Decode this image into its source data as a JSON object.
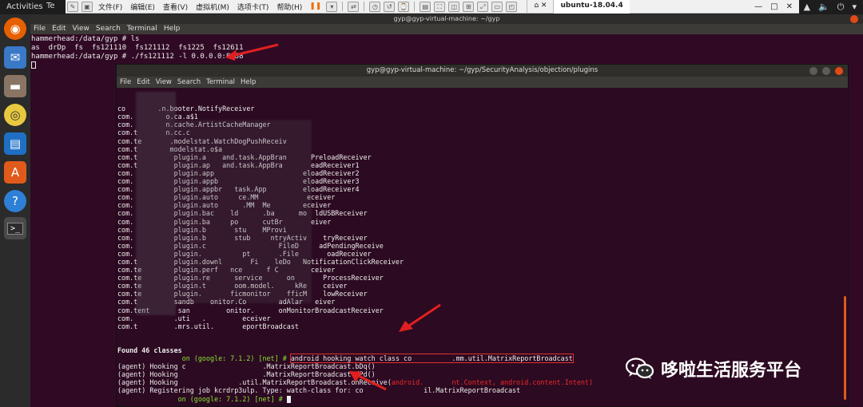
{
  "topbar": {
    "activities": "Activities",
    "vm_tab": "Te",
    "tray": [
      "▲",
      "🔈",
      "⏻",
      "▾"
    ]
  },
  "vmware": {
    "menus": [
      "文件(F)",
      "编辑(E)",
      "查看(V)",
      "虚拟机(M)",
      "选项卡(T)",
      "帮助(H)"
    ],
    "tab": "ubuntu-18.04.4",
    "window_controls": [
      "—",
      "□",
      "✕"
    ]
  },
  "dock": {
    "apps": [
      "firefox-icon",
      "thunderbird-icon",
      "files-icon",
      "rhythmbox-icon",
      "writer-icon",
      "software-icon",
      "help-icon",
      "terminal-icon"
    ]
  },
  "terminal_back": {
    "title": "gyp@gyp-virtual-machine: ~/gyp",
    "menus": [
      "File",
      "Edit",
      "View",
      "Search",
      "Terminal",
      "Help"
    ],
    "lines": [
      "hammerhead:/data/gyp # ls",
      "as  drDp  fs  fs121110  fs121112  fs1225  fs12611",
      "hammerhead:/data/gyp # ./fs121112 -l 0.0.0.0:8888"
    ]
  },
  "terminal_front": {
    "title": "gyp@gyp-virtual-machine: ~/gyp/SecurityAnalysis/objection/plugins",
    "menus": [
      "File",
      "Edit",
      "View",
      "Search",
      "Terminal",
      "Help"
    ],
    "class_lines": [
      "co        .n.booter.NotifyReceiver",
      "com.        o.ca.a$1",
      "com.        n.cache.ArtistCacheManager",
      "com.t       n.cc.c",
      "com.te       .modelstat.WatchDogPushReceiv",
      "com.t        modelstat.o$a",
      "com.t         plugin.a    and.task.AppBran      PreloadReceiver",
      "com.t         plugin.ap   and.task.AppBra       eadReceiver1",
      "com.          plugin.app                      eloadReceiver2",
      "com.          plugin.appb                     eloadReceiver3",
      "com.          plugin.appbr   task.App         eloadReceiver4",
      "com.          plugin.auto     ce.MM            eceiver",
      "com.          plugin.auto      .MM  Me        eceiver",
      "com.          plugin.bac    ld      .ba      mo  ldUSBReceiver",
      "com.          plugin.ba     po      cutBr       eiver",
      "com.          plugin.b       stu    MProvi",
      "com.          plugin.b       stub     ntryActiv    tryReceiver",
      "com.          plugin.c                  FileD     adPendingReceive",
      "com.          plugin.          pt       .File       oadReceiver",
      "com.t         plugin.downl       Fi    leDo   NotificationClickReceiver",
      "com.te        plugin.perf   nce      f C        ceiver",
      "com.te        plugin.re      service      on       ProcessReceiver",
      "com.te        plugin.t       oom.model.     kRe    ceiver",
      "com.te        plugin.       ficmonitor    fficM    lowReceiver",
      "com.t         sandb    onitor.Co        adAlar   eiver",
      "com.tent       san         onitor.      onMonitorBroadcastReceiver",
      "com.          .uti   .         eceiver",
      "com.t         .mrs.util.       eportBroadcast"
    ],
    "found": "Found 46 classes",
    "prompt_device": "on (google: 7.1.2) [net] #",
    "command": "android hooking watch class co          .mm.util.MatrixReportBroadcast",
    "agent_lines": [
      "(agent) Hooking c                   .MatrixReportBroadcast.bDq()",
      "(agent) Hooking                     .MatrixReportBroadcast.dPd()",
      "(agent) Hooking               .util.MatrixReportBroadcast.onReceive(",
      "(agent) Registering job kcrdrp3ulp. Type: watch-class for: co               il.MatrixReportBroadcast"
    ],
    "onreceive_args": "android.       nt.Context, android.content.Intent)",
    "final_prompt": "on (google: 7.1.2) [net] #"
  },
  "watermark": {
    "text": "哆啦生活服务平台"
  }
}
